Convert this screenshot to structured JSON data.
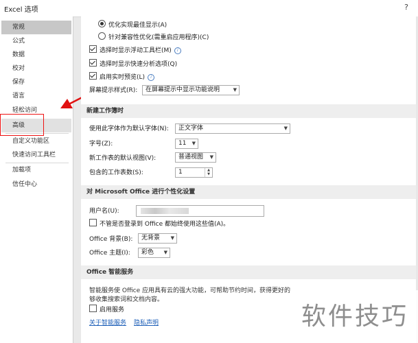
{
  "window": {
    "title": "Excel 选项",
    "help": "?"
  },
  "nav": {
    "items": [
      "常规",
      "公式",
      "数据",
      "校对",
      "保存",
      "语言",
      "轻松访问",
      "高级",
      "自定义功能区",
      "快速访问工具栏",
      "加载项",
      "信任中心"
    ],
    "active": "常规",
    "highlighted": "高级"
  },
  "general": {
    "radio_optimize_best": "优化实现最佳显示(A)",
    "radio_optimize_compat": "针对兼容性优化(需重启应用程序)(C)",
    "cb_mini_toolbar": "选择时显示浮动工具栏(M)",
    "cb_quick_analysis": "选择时显示快速分析选项(Q)",
    "cb_live_preview": "启用实时预览(L)",
    "screentip_label": "屏幕提示样式(R):",
    "screentip_value": "在屏幕提示中显示功能说明"
  },
  "new_workbook": {
    "header": "新建工作簿时",
    "font_label": "使用此字体作为默认字体(N):",
    "font_value": "正文字体",
    "size_label": "字号(Z):",
    "size_value": "11",
    "view_label": "新工作表的默认视图(V):",
    "view_value": "普通视图",
    "sheets_label": "包含的工作表数(S):",
    "sheets_value": "1"
  },
  "personalize": {
    "header": "对 Microsoft Office 进行个性化设置",
    "username_label": "用户名(U):",
    "cb_always_use": "不管是否登录到 Office 都始终使用这些值(A)。",
    "background_label": "Office 背景(B):",
    "background_value": "无背景",
    "theme_label": "Office 主题(I):",
    "theme_value": "彩色"
  },
  "intelligent": {
    "header": "Office 智能服务",
    "description": "智能服务使 Office 应用具有云的强大功能，可帮助节约时间，获得更好的",
    "description2": "够收集搜索词和文档内容。",
    "cb_enable": "启用服务",
    "link_about": "关于智能服务",
    "link_privacy": "隐私声明"
  },
  "watermark": "软件技巧",
  "colors": {
    "annotation": "#e11111",
    "link": "#1d5fb8"
  }
}
